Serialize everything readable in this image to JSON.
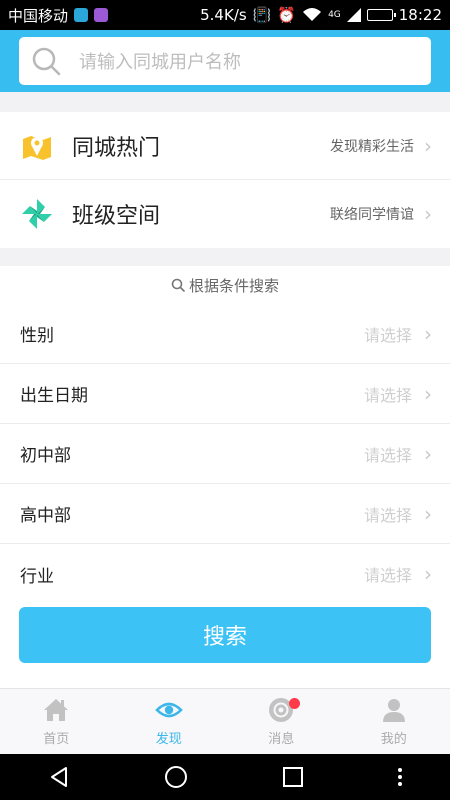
{
  "status_bar": {
    "carrier": "中国移动",
    "speed": "5.4K/s",
    "network": "4G",
    "time": "18:22"
  },
  "search": {
    "placeholder": "请输入同城用户名称"
  },
  "features": [
    {
      "title": "同城热门",
      "subtitle": "发现精彩生活",
      "icon": "map-pin-icon"
    },
    {
      "title": "班级空间",
      "subtitle": "联络同学情谊",
      "icon": "pinwheel-icon"
    }
  ],
  "condition_search": {
    "heading": "根据条件搜索",
    "rows": [
      {
        "label": "性别",
        "value": "请选择"
      },
      {
        "label": "出生日期",
        "value": "请选择"
      },
      {
        "label": "初中部",
        "value": "请选择"
      },
      {
        "label": "高中部",
        "value": "请选择"
      },
      {
        "label": "行业",
        "value": "请选择"
      }
    ],
    "button": "搜索"
  },
  "tabs": [
    {
      "label": "首页",
      "icon": "home-icon",
      "active": false
    },
    {
      "label": "发现",
      "icon": "eye-icon",
      "active": true
    },
    {
      "label": "消息",
      "icon": "message-icon",
      "active": false
    },
    {
      "label": "我的",
      "icon": "person-icon",
      "active": false
    }
  ],
  "colors": {
    "accent": "#38bdf0",
    "active_tab": "#3bb7ea",
    "badge": "#ff3b4a",
    "feature_yellow": "#f7c22b",
    "feature_teal": "#2ecfa9"
  }
}
